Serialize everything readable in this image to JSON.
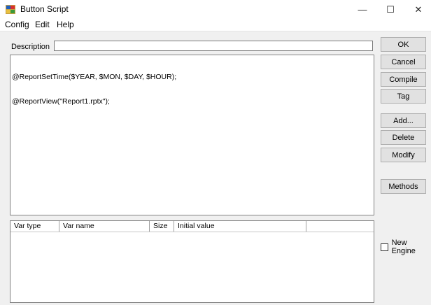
{
  "window": {
    "title": "Button Script",
    "controls": {
      "minimize": "—",
      "maximize": "☐",
      "close": "✕"
    }
  },
  "menu": [
    "Config",
    "Edit",
    "Help"
  ],
  "description": {
    "label": "Description",
    "value": ""
  },
  "script": {
    "lines": [
      "@ReportSetTime($YEAR, $MON, $DAY, $HOUR);",
      "@ReportView(\"Report1.rptx\");"
    ]
  },
  "var_table": {
    "columns": [
      "Var type",
      "Var name",
      "Size",
      "Initial value",
      ""
    ],
    "rows": []
  },
  "buttons": {
    "ok": "OK",
    "cancel": "Cancel",
    "compile": "Compile",
    "tag": "Tag",
    "add": "Add...",
    "delete": "Delete",
    "modify": "Modify",
    "methods": "Methods"
  },
  "new_engine": {
    "label": "New Engine",
    "checked": false
  }
}
